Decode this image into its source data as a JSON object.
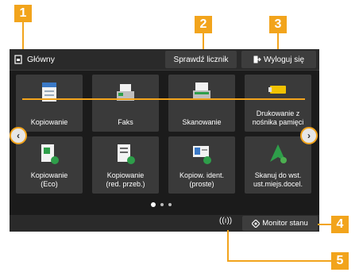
{
  "header": {
    "home_label": "Główny",
    "counter_label": "Sprawdź licznik",
    "logout_label": "Wyloguj się"
  },
  "tiles": [
    {
      "label": "Kopiowanie",
      "icon": "copy-icon"
    },
    {
      "label": "Faks",
      "icon": "fax-icon"
    },
    {
      "label": "Skanowanie",
      "icon": "scan-icon"
    },
    {
      "label_line1": "Drukowanie z",
      "label_line2": "nośnika pamięci",
      "icon": "memory-print-icon"
    },
    {
      "label_line1": "Kopiowanie",
      "label_line2": "(Eco)",
      "icon": "eco-copy-icon"
    },
    {
      "label_line1": "Kopiowanie",
      "label_line2": "(red. przeb.)",
      "icon": "reduced-copy-icon"
    },
    {
      "label_line1": "Kopiow. ident.",
      "label_line2": "(proste)",
      "icon": "id-copy-icon"
    },
    {
      "label_line1": "Skanuj do wst.",
      "label_line2": "ust.miejs.docel.",
      "icon": "scan-preset-icon"
    }
  ],
  "footer": {
    "status_monitor_label": "Monitor stanu",
    "wifi_glyph": "((ı))"
  },
  "callouts": [
    "1",
    "2",
    "3",
    "4",
    "5"
  ],
  "colors": {
    "accent": "#f2a41c",
    "screen": "#1b1b1b",
    "tile": "#3a3a3a"
  }
}
